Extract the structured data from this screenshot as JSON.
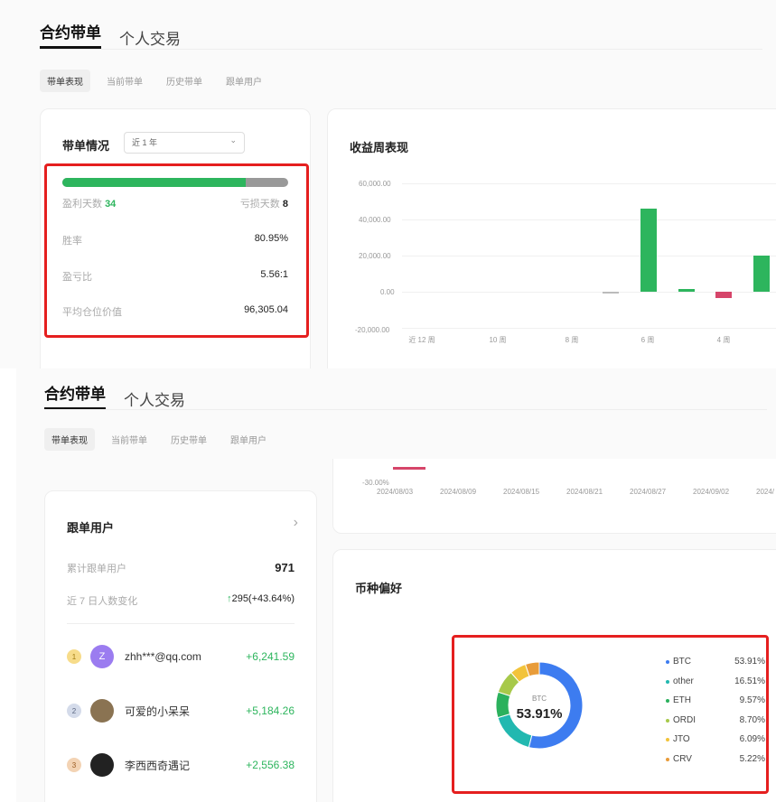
{
  "top": {
    "tabs": [
      "合约带单",
      "个人交易"
    ],
    "subtabs": [
      "带单表现",
      "当前带单",
      "历史带单",
      "跟单用户"
    ],
    "summary": {
      "title": "带单情况",
      "period": "近 1 年",
      "win_days_label": "盈利天数",
      "win_days": "34",
      "loss_days_label": "亏损天数",
      "loss_days": "8",
      "win_fraction": 0.81,
      "rows": [
        {
          "label": "胜率",
          "value": "80.95%"
        },
        {
          "label": "盈亏比",
          "value": "5.56:1"
        },
        {
          "label": "平均仓位价值",
          "value": "96,305.04"
        }
      ]
    },
    "weekly": {
      "title": "收益周表现",
      "chart_data": {
        "type": "bar",
        "title": "收益周表现",
        "yticks": [
          "60,000.00",
          "40,000.00",
          "20,000.00",
          "0.00",
          "-20,000.00"
        ],
        "ylim": [
          -20000,
          60000
        ],
        "xticks": [
          "近 12 周",
          "10 周",
          "8 周",
          "6 周",
          "4 周"
        ],
        "values": [
          0,
          0,
          0,
          0,
          0,
          -300,
          46000,
          1500,
          -3500,
          20000
        ],
        "colors": {
          "positive": "#2db55d",
          "negative": "#d6456a",
          "neutral": "#bbbbbb"
        }
      }
    }
  },
  "bottom": {
    "tabs": [
      "合约带单",
      "个人交易"
    ],
    "subtabs": [
      "带单表现",
      "当前带单",
      "历史带单",
      "跟单用户"
    ],
    "return_chart": {
      "ytick": "-30.00%",
      "dates": [
        "2024/08/03",
        "2024/08/09",
        "2024/08/15",
        "2024/08/21",
        "2024/08/27",
        "2024/09/02",
        "2024/"
      ]
    },
    "followers": {
      "title": "跟单用户",
      "total_label": "累计跟单用户",
      "total": "971",
      "change_label": "近 7 日人数变化",
      "change": "295(+43.64%)",
      "list": [
        {
          "rank": "1",
          "initial": "Z",
          "name": "zhh***@qq.com",
          "profit": "+6,241.59",
          "avatar_color": "#9b7cf0",
          "medal_color": "#f7dc8a"
        },
        {
          "rank": "2",
          "initial": "",
          "name": "可爱的小呆呆",
          "profit": "+5,184.26",
          "avatar_color": "#8a7352",
          "medal_color": "#d4dbea"
        },
        {
          "rank": "3",
          "initial": "",
          "name": "李西西奇遇记",
          "profit": "+2,556.38",
          "avatar_color": "#222222",
          "medal_color": "#f3d3b4"
        }
      ]
    },
    "coins": {
      "title": "币种偏好",
      "center_label": "BTC",
      "center_value": "53.91%",
      "chart_data": {
        "type": "pie",
        "labels": [
          "BTC",
          "other",
          "ETH",
          "ORDI",
          "JTO",
          "CRV"
        ],
        "values": [
          53.91,
          16.51,
          9.57,
          8.7,
          6.09,
          5.22
        ],
        "display": [
          "53.91%",
          "16.51%",
          "9.57%",
          "8.70%",
          "6.09%",
          "5.22%"
        ],
        "colors": [
          "#3d7cf0",
          "#22b8b0",
          "#2bb15d",
          "#a7c94a",
          "#f2c33a",
          "#e89c3a"
        ]
      }
    }
  }
}
